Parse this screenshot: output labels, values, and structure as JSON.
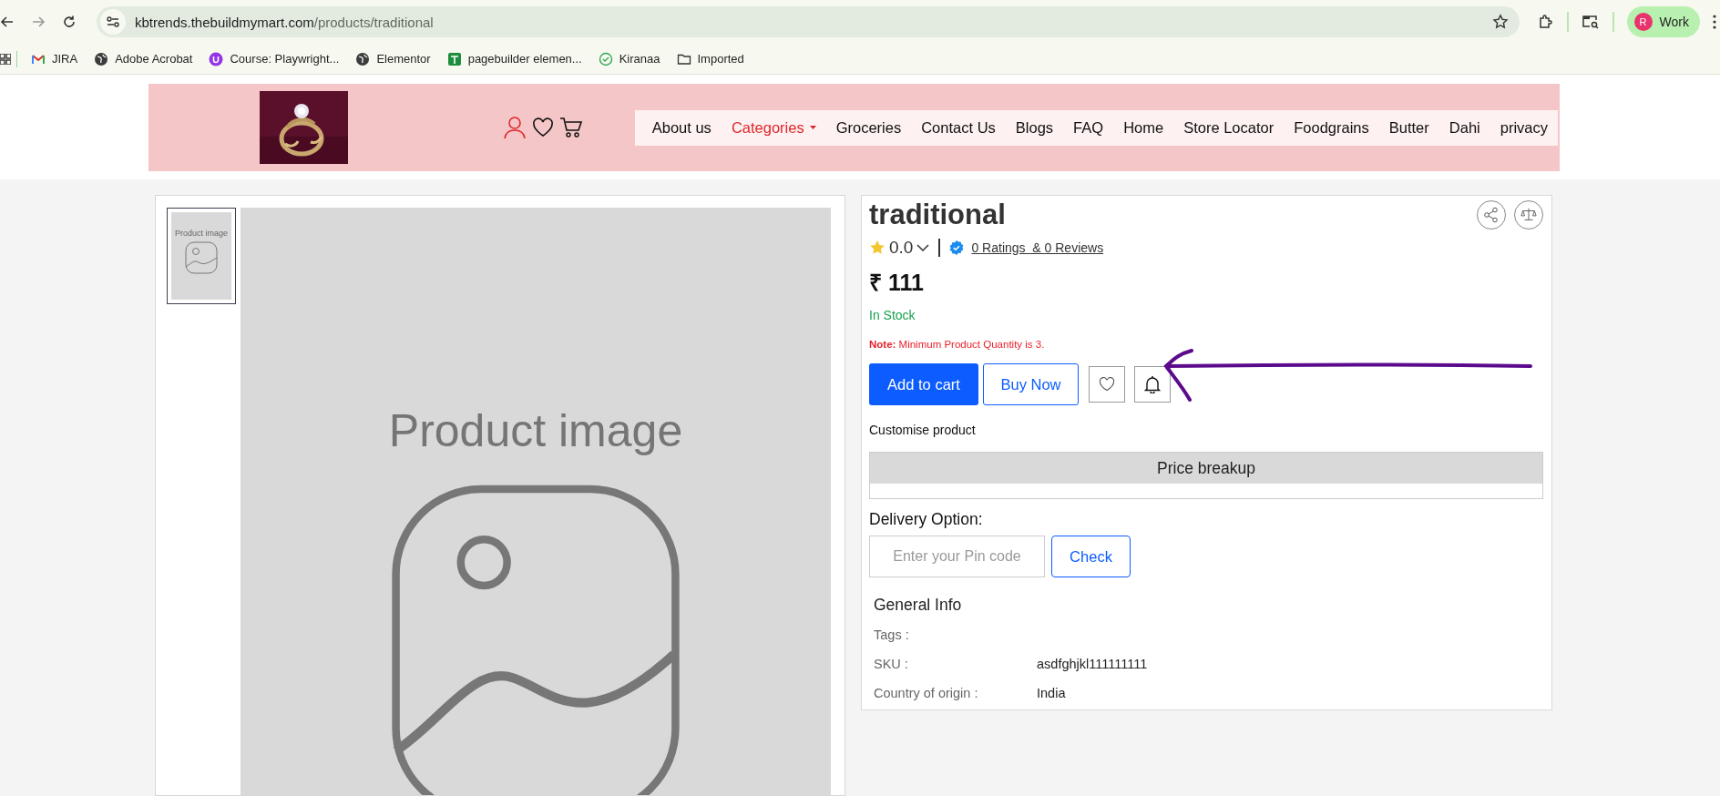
{
  "browser": {
    "url": {
      "host": "kbtrends.thebuildmymart.com",
      "path": "/products/traditional"
    },
    "bookmarks": [
      {
        "kind": "mail",
        "label": "JIRA"
      },
      {
        "kind": "globe",
        "label": "Adobe Acrobat"
      },
      {
        "kind": "course",
        "label": "Course: Playwright..."
      },
      {
        "kind": "globe",
        "label": "Elementor"
      },
      {
        "kind": "sheet",
        "label": "pagebuilder elemen..."
      },
      {
        "kind": "check",
        "label": "Kiranaa"
      },
      {
        "kind": "folder",
        "label": "Imported"
      }
    ],
    "profile": {
      "initial": "R",
      "label": "Work"
    }
  },
  "header": {
    "nav": [
      {
        "label": "About us",
        "selected": false,
        "dropdown": false
      },
      {
        "label": "Categories",
        "selected": true,
        "dropdown": true
      },
      {
        "label": "Groceries",
        "selected": false,
        "dropdown": false
      },
      {
        "label": "Contact Us",
        "selected": false,
        "dropdown": false
      },
      {
        "label": "Blogs",
        "selected": false,
        "dropdown": false
      },
      {
        "label": "FAQ",
        "selected": false,
        "dropdown": false
      },
      {
        "label": "Home",
        "selected": false,
        "dropdown": false
      },
      {
        "label": "Store Locator",
        "selected": false,
        "dropdown": false
      },
      {
        "label": "Foodgrains",
        "selected": false,
        "dropdown": false
      },
      {
        "label": "Butter",
        "selected": false,
        "dropdown": false
      },
      {
        "label": "Dahi",
        "selected": false,
        "dropdown": false
      },
      {
        "label": "privacy",
        "selected": false,
        "dropdown": false
      }
    ]
  },
  "gallery": {
    "thumbnails": [
      {
        "text": "Product image",
        "selected": true
      }
    ],
    "main_image_text": "Product image"
  },
  "product": {
    "title": "traditional",
    "rating": "0.0",
    "reviews_link": "0 Ratings  & 0 Reviews",
    "price": "₹ 111",
    "stock": "In Stock",
    "note": "**Note:** Minimum Product Quantity is 3.",
    "add_to_cart": "Add to cart",
    "buy_now": "Buy Now",
    "customise": "Customise product",
    "price_breakup": "Price breakup",
    "delivery": {
      "label": "Delivery Option:",
      "placeholder": "Enter your Pin code",
      "button": "Check"
    },
    "general_info": {
      "title": "General Info",
      "rows": [
        {
          "label": "Tags :"
        },
        {
          "label": "SKU :",
          "value": "asdfghjkl111111111"
        },
        {
          "label": "Country of origin :",
          "value": "India"
        }
      ]
    }
  },
  "annotation": {
    "kind": "arrow"
  }
}
